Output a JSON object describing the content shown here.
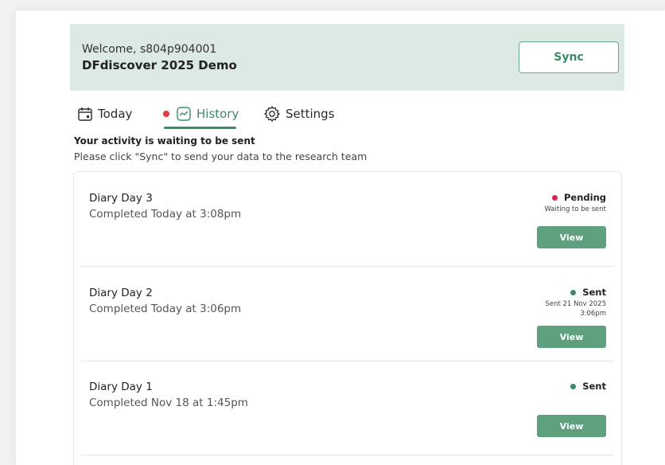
{
  "colors": {
    "accent": "#3f8a66",
    "banner_bg": "#dde9e3",
    "pending": "#d6244f",
    "sent": "#3f8a66",
    "view_button": "#5fa07f"
  },
  "header": {
    "welcome": "Welcome, s804p904001",
    "study_name": "DFdiscover 2025 Demo",
    "sync_label": "Sync"
  },
  "tabs": [
    {
      "label": "Today",
      "icon": "calendar-icon"
    },
    {
      "label": "History",
      "icon": "history-chart-icon",
      "active": true,
      "has_notification_dot": true
    },
    {
      "label": "Settings",
      "icon": "gear-icon"
    }
  ],
  "notice": {
    "title": "Your activity is waiting to be sent",
    "subtitle": "Please click \"Sync\" to send your data to the research team"
  },
  "entries": [
    {
      "title": "Diary Day 3",
      "completed": "Completed Today at 3:08pm",
      "status": "Pending",
      "status_color": "#d6244f",
      "detail_line1": "Waiting to be sent",
      "detail_line2": "",
      "view_label": "View"
    },
    {
      "title": "Diary Day 2",
      "completed": "Completed Today at 3:06pm",
      "status": "Sent",
      "status_color": "#3f8a66",
      "detail_line1": "Sent 21 Nov 2025",
      "detail_line2": "3:06pm",
      "view_label": "View"
    },
    {
      "title": "Diary Day 1",
      "completed": "Completed Nov 18 at 1:45pm",
      "status": "Sent",
      "status_color": "#3f8a66",
      "detail_line1": "",
      "detail_line2": "",
      "view_label": "View"
    }
  ]
}
